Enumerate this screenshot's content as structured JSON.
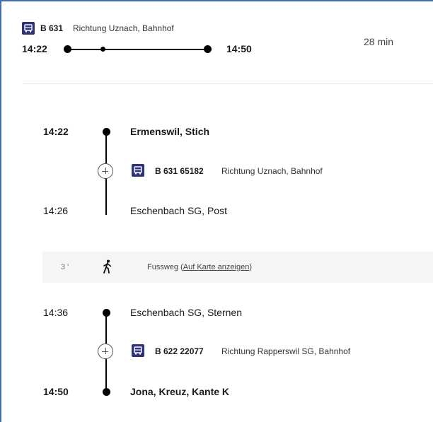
{
  "header": {
    "line": "B 631",
    "direction": "Richtung Uznach, Bahnhof",
    "departure": "14:22",
    "arrival": "14:50",
    "duration": "28 min"
  },
  "legs": [
    {
      "from_time": "14:22",
      "from_stop": "Ermenswil, Stich",
      "service": "B 631 65182",
      "direction": "Richtung Uznach, Bahnhof",
      "to_time": "14:26",
      "to_stop": "Eschenbach SG, Post"
    },
    {
      "from_time": "14:36",
      "from_stop": "Eschenbach SG, Sternen",
      "service": "B 622 22077",
      "direction": "Richtung Rapperswil SG, Bahnhof",
      "to_time": "14:50",
      "to_stop": "Jona, Kreuz, Kante K"
    }
  ],
  "walk": {
    "duration": "3 '",
    "label": "Fussweg (",
    "link": "Auf Karte anzeigen",
    "label_end": ")"
  },
  "icons": [
    "bus-icon",
    "walk-icon",
    "plus-icon"
  ],
  "colors": {
    "accent": "#2d327d",
    "frame": "#3d6fb6"
  }
}
